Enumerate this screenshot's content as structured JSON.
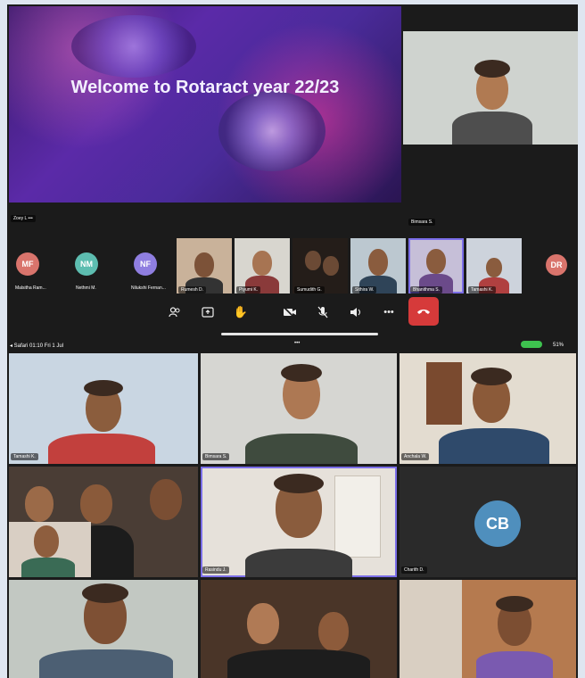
{
  "slide": {
    "title": "Welcome to Rotaract year 22/23",
    "presenter_tag": "Zoey L"
  },
  "spotlight": {
    "name": "Bimsara S."
  },
  "strip": [
    {
      "initials": "MF",
      "label": "Malsitha Ram...",
      "color": "#d9746c"
    },
    {
      "initials": "NM",
      "label": "Nethmi M.",
      "color": "#5dbdb0"
    },
    {
      "initials": "NF",
      "label": "Nilukshi Fernan...",
      "color": "#8f7ee0"
    },
    {
      "label": "Rumesh D."
    },
    {
      "label": "Piyumi K."
    },
    {
      "label": "Sumudith G."
    },
    {
      "label": "Sithira W."
    },
    {
      "label": "Bhanithma S."
    },
    {
      "label": "Tamashi K."
    },
    {
      "initials": "DR",
      "label": "",
      "color": "#d9746c"
    }
  ],
  "controls": [
    "participants-icon",
    "share-icon",
    "raise-hand-icon",
    "video-off-icon",
    "mute-icon",
    "speaker-icon",
    "more-icon",
    "leave-icon"
  ],
  "status_bar": {
    "left": "◂ Safari  01:10  Fri 1 Jul",
    "center": "•••",
    "right": "51%"
  },
  "grid": [
    {
      "name": "Tamashi K."
    },
    {
      "name": "Bimsara S."
    },
    {
      "name": "Anchala W."
    },
    {
      "name": ""
    },
    {
      "name": "Rasindu J."
    },
    {
      "name": "Charith D.",
      "initials": "CB",
      "color": "#4f8fbd"
    },
    {
      "name": ""
    },
    {
      "name": ""
    },
    {
      "name": ""
    }
  ]
}
